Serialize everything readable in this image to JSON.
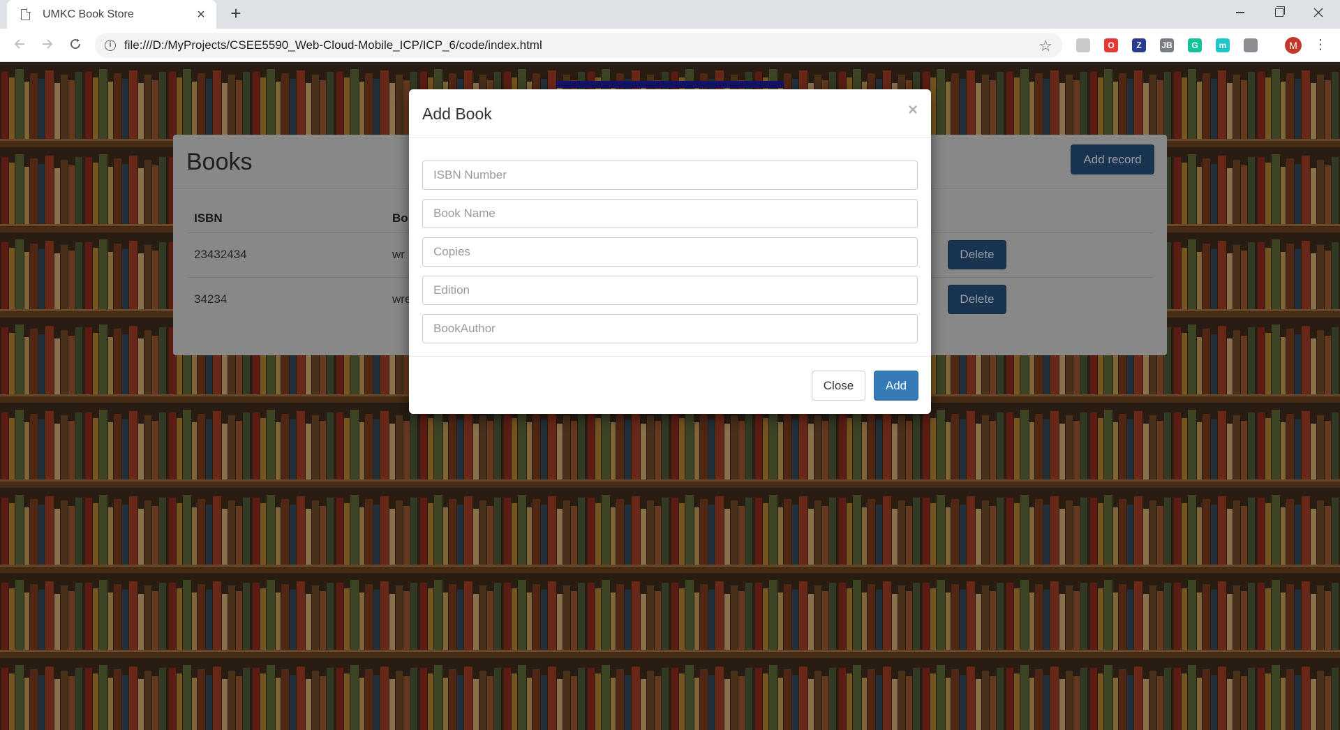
{
  "browser": {
    "tab_title": "UMKC Book Store",
    "tab_close": "×",
    "new_tab": "+",
    "url": "file:///D:/MyProjects/CSEE5590_Web-Cloud-Mobile_ICP/ICP_6/code/index.html",
    "profile_initial": "M",
    "extensions": [
      {
        "name": "pdf-extension-icon",
        "glyph": "",
        "color": "#c7c9cc"
      },
      {
        "name": "opera-extension-icon",
        "glyph": "O",
        "color": "#e53935"
      },
      {
        "name": "zotero-extension-icon",
        "glyph": "Z",
        "color": "#2b3a8f"
      },
      {
        "name": "jb-extension-icon",
        "glyph": "JB",
        "color": "#7a7d82"
      },
      {
        "name": "grammarly-extension-icon",
        "glyph": "G",
        "color": "#15c39a"
      },
      {
        "name": "mercury-extension-icon",
        "glyph": "m",
        "color": "#1ec8c8"
      },
      {
        "name": "camera-extension-icon",
        "glyph": "",
        "color": "#8a8d91"
      }
    ]
  },
  "page": {
    "panel_title": "Books",
    "add_record_label": "Add record",
    "columns": [
      "ISBN",
      "Bo"
    ],
    "rows": [
      {
        "isbn": "23432434",
        "book": "wr",
        "action": "Delete"
      },
      {
        "isbn": "34234",
        "book": "wre",
        "action": "Delete"
      }
    ]
  },
  "modal": {
    "title": "Add Book",
    "close_glyph": "×",
    "fields": [
      {
        "placeholder": "ISBN Number"
      },
      {
        "placeholder": "Book Name"
      },
      {
        "placeholder": "Copies"
      },
      {
        "placeholder": "Edition"
      },
      {
        "placeholder": "BookAuthor"
      }
    ],
    "close_label": "Close",
    "add_label": "Add"
  }
}
